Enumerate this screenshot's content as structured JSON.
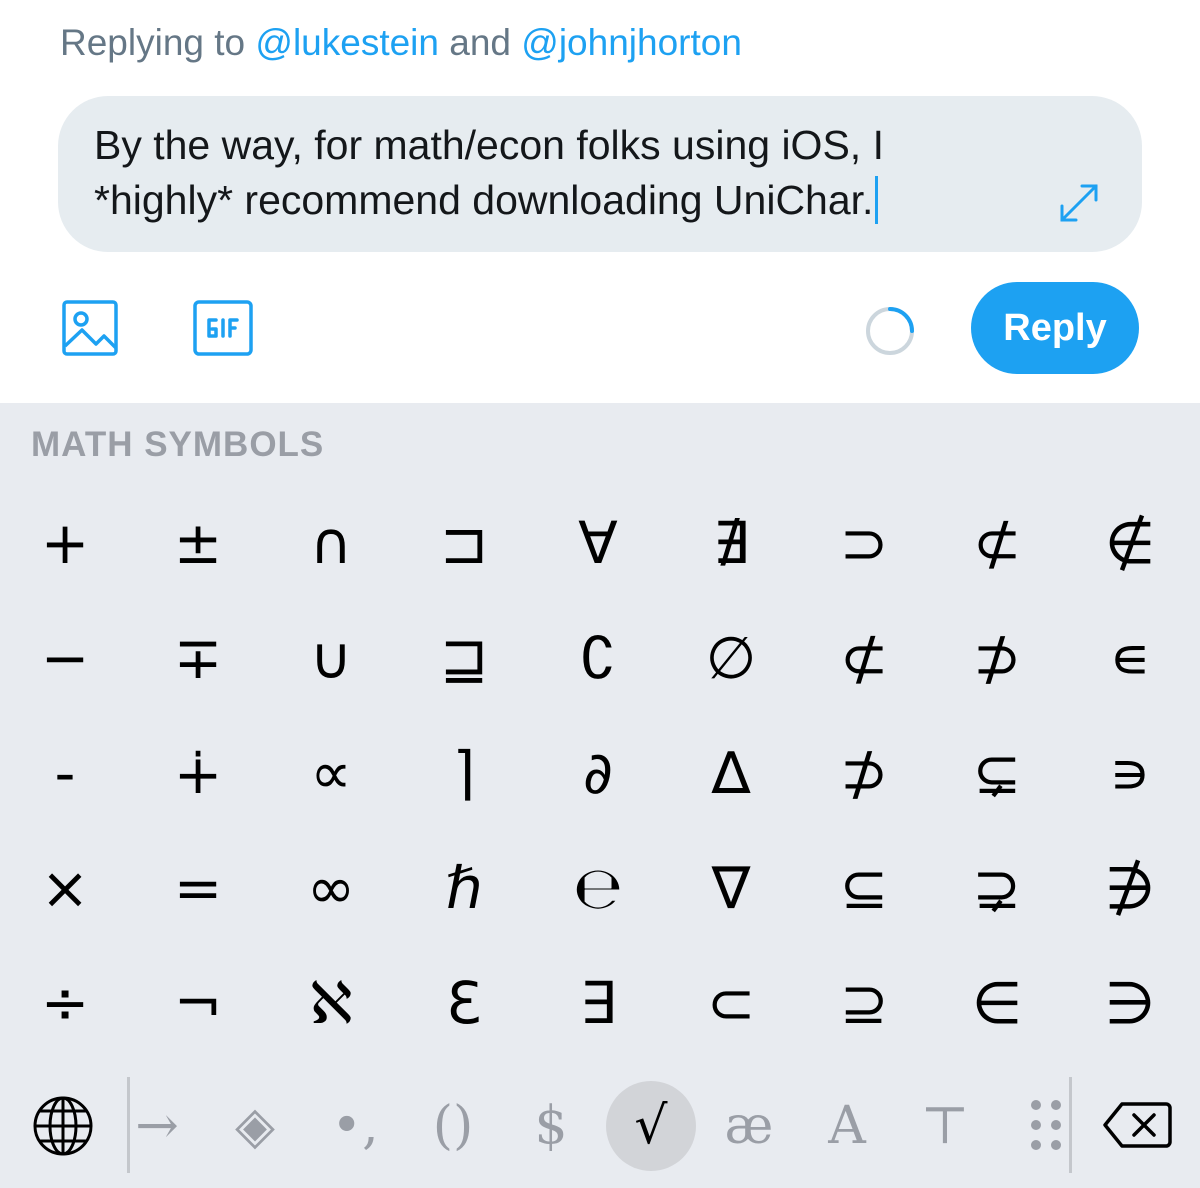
{
  "reply_header": {
    "prefix": "Replying to ",
    "mention_1": "@lukestein",
    "joiner": " and ",
    "mention_2": "@johnjhorton"
  },
  "compose": {
    "text": "By the way, for math/econ folks using iOS, I\n*highly* recommend downloading UniChar."
  },
  "toolbar": {
    "reply_label": "Reply"
  },
  "keyboard": {
    "title": "MATH SYMBOLS",
    "symbols": [
      [
        "+",
        "±",
        "∩",
        "⊐",
        "∀",
        "∄",
        "⊃",
        "⊄",
        "∉"
      ],
      [
        "−",
        "∓",
        "∪",
        "⊒",
        "∁",
        "∅",
        "⊄",
        "⊅",
        "∊"
      ],
      [
        "-",
        "∔",
        "∝",
        "⌉",
        "∂",
        "∆",
        "⊅",
        "⊊",
        "∍"
      ],
      [
        "×",
        "=",
        "∞",
        "ℏ",
        "℮",
        "∇",
        "⊆",
        "⊋",
        "∌"
      ],
      [
        "÷",
        "¬",
        "ℵ",
        "Ɛ",
        "∃",
        "⊂",
        "⊇",
        "∈",
        "∋"
      ]
    ],
    "bottom_keys": [
      "→",
      "◈",
      "•,",
      "()",
      "$",
      "√",
      "æ",
      "A",
      "⊤"
    ],
    "active_key": "√"
  },
  "colors": {
    "accent": "#1da1f2",
    "compose_bg": "#e6ecf0",
    "keyboard_bg": "#e8ebf0",
    "muted_text": "#9a9ea6"
  }
}
